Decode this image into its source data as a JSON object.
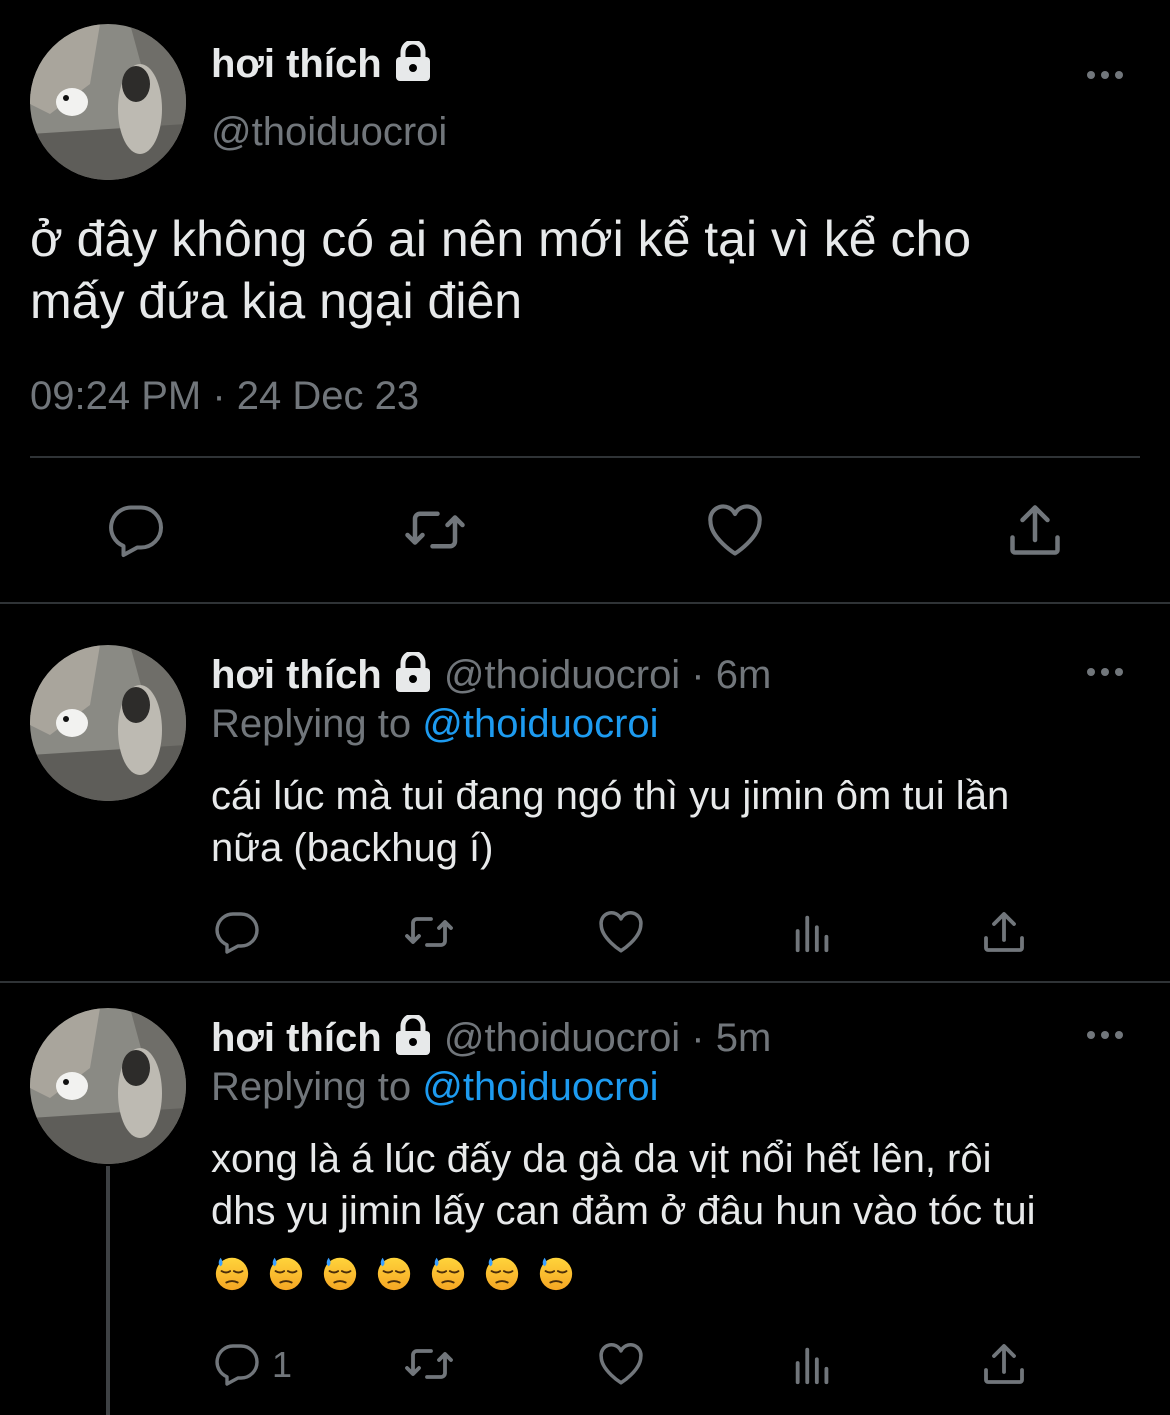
{
  "main_tweet": {
    "display_name": "hơi thích",
    "handle": "@thoiduocroi",
    "text_line1": "ở đây không có ai nên mới kể tại vì kể cho",
    "text_line2": "mấy đứa kia ngại điên",
    "timestamp": "09:24 PM · 24 Dec 23"
  },
  "reply1": {
    "display_name": "hơi thích",
    "handle_time": "@thoiduocroi · 6m",
    "replying_prefix": "Replying to",
    "replying_handle": "@thoiduocroi",
    "text_line1": "cái lúc mà tui đang ngó thì yu jimin ôm tui lần",
    "text_line2": "nữa (backhug í)"
  },
  "reply2": {
    "display_name": "hơi thích",
    "handle_time": "@thoiduocroi · 5m",
    "replying_prefix": "Replying to",
    "replying_handle": "@thoiduocroi",
    "text_line1": "xong là á lúc đấy da gà da vịt nổi hết lên, rôi",
    "text_line2": "dhs yu jimin lấy can đảm ở đâu hun vào tóc tui",
    "emoji_count": 7,
    "reply_count": "1"
  },
  "icons": {
    "reply": "speech-bubble-icon",
    "retweet": "retweet-icon",
    "like": "heart-icon",
    "views": "bar-chart-icon",
    "share": "share-icon",
    "more": "more-icon",
    "lock": "lock-icon"
  },
  "colors": {
    "background": "#000000",
    "text": "#e7e9ea",
    "muted": "#71767b",
    "link": "#1d9bf0",
    "divider": "#2f3336"
  }
}
